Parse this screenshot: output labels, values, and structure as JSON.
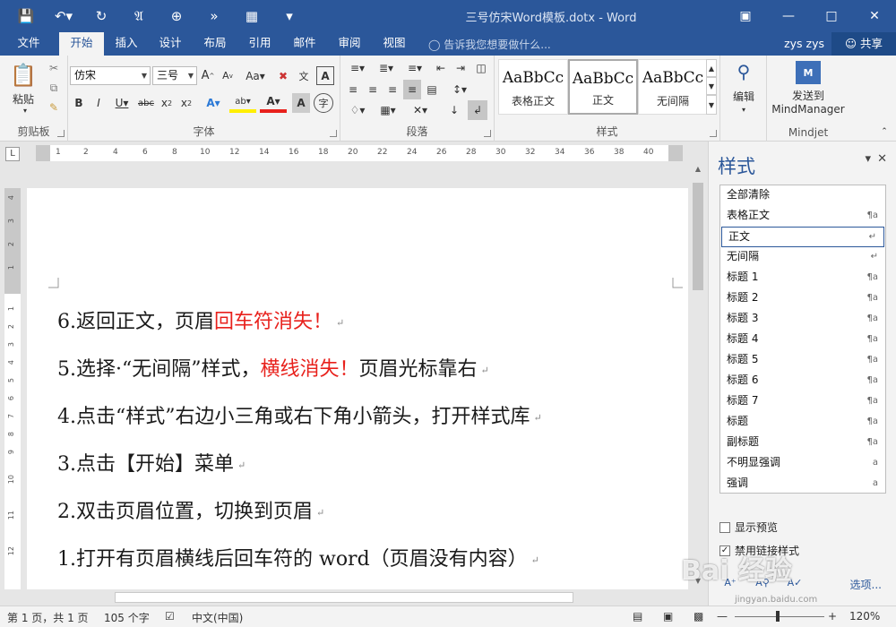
{
  "window": {
    "title": "三号仿宋Word模板.dotx - Word",
    "qat": [
      "save-icon",
      "undo-icon",
      "redo-icon",
      "format-painter-icon",
      "touch-mode-icon",
      "forward-icon",
      "table-icon",
      "customize-icon"
    ]
  },
  "tabs": [
    "文件",
    "开始",
    "插入",
    "设计",
    "布局",
    "引用",
    "邮件",
    "审阅",
    "视图"
  ],
  "active_tab": "开始",
  "tell_me": "告诉我您想要做什么...",
  "user": "zys zys",
  "share": "共享",
  "ribbon": {
    "clipboard": {
      "label": "剪贴板",
      "paste": "粘贴"
    },
    "font": {
      "label": "字体",
      "font_name": "仿宋",
      "font_size": "三号",
      "aa_label": "Aa",
      "wen_label": "文",
      "A_label": "A"
    },
    "paragraph": {
      "label": "段落"
    },
    "styles": {
      "label": "样式",
      "items": [
        {
          "sample": "AaBbCc",
          "name": "表格正文"
        },
        {
          "sample": "AaBbCc",
          "name": "正文",
          "selected": true
        },
        {
          "sample": "AaBbCc",
          "name": "无间隔"
        }
      ]
    },
    "editing": {
      "label": "编辑"
    },
    "mindjet": {
      "label": "Mindjet",
      "button": "发送到",
      "button2": "MindManager"
    }
  },
  "ruler_numbers": [
    "1",
    "2",
    "4",
    "6",
    "8",
    "10",
    "12",
    "14",
    "16",
    "18",
    "20",
    "22",
    "24",
    "26",
    "28",
    "30",
    "32",
    "34",
    "36",
    "38",
    "40"
  ],
  "vruler_numbers": [
    "4",
    "3",
    "2",
    "1",
    "1",
    "2",
    "3",
    "4",
    "5",
    "6",
    "7",
    "8",
    "9",
    "10",
    "11",
    "12"
  ],
  "document": {
    "lines": [
      {
        "pre": "6.返回正文，页眉",
        "red": "回车符消失！",
        "post": ""
      },
      {
        "pre": "5.选择·“无间隔”样式，",
        "red": "横线消失！",
        "post": "页眉光标靠右"
      },
      {
        "pre": "4.点击“样式”右边小三角或右下角小箭头，打开样式库",
        "red": "",
        "post": ""
      },
      {
        "pre": "3.点击【开始】菜单",
        "red": "",
        "post": ""
      },
      {
        "pre": "2.双击页眉位置，切换到页眉",
        "red": "",
        "post": ""
      },
      {
        "pre": "1.打开有页眉横线后回车符的 word（页眉没有内容）",
        "red": "",
        "post": ""
      }
    ]
  },
  "styles_pane": {
    "title": "样式",
    "items": [
      {
        "name": "全部清除",
        "mark": ""
      },
      {
        "name": "表格正文",
        "mark": "¶a"
      },
      {
        "name": "正文",
        "mark": "↵",
        "selected": true
      },
      {
        "name": "无间隔",
        "mark": "↵"
      },
      {
        "name": "标题 1",
        "mark": "¶a"
      },
      {
        "name": "标题 2",
        "mark": "¶a"
      },
      {
        "name": "标题 3",
        "mark": "¶a"
      },
      {
        "name": "标题 4",
        "mark": "¶a"
      },
      {
        "name": "标题 5",
        "mark": "¶a"
      },
      {
        "name": "标题 6",
        "mark": "¶a"
      },
      {
        "name": "标题 7",
        "mark": "¶a"
      },
      {
        "name": "标题",
        "mark": "¶a"
      },
      {
        "name": "副标题",
        "mark": "¶a"
      },
      {
        "name": "不明显强调",
        "mark": "a"
      },
      {
        "name": "强调",
        "mark": "a"
      }
    ],
    "show_preview": "显示预览",
    "disable_linked": "禁用链接样式",
    "options": "选项..."
  },
  "status": {
    "page": "第 1 页，共 1 页",
    "words": "105 个字",
    "lang": "中文(中国)",
    "zoom": "120%"
  },
  "watermark": "Bai 经验",
  "watermark_url": "jingyan.baidu.com"
}
